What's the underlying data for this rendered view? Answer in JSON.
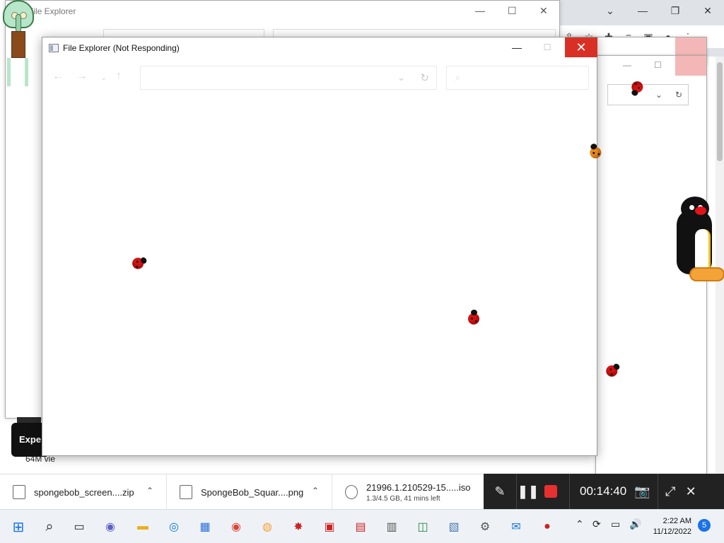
{
  "browser": {
    "controls": [
      "chevron-down",
      "minimize",
      "restore",
      "close"
    ]
  },
  "back_window": {
    "title": "File Explorer"
  },
  "main_window": {
    "title": "File Explorer (Not Responding)",
    "address_value": "",
    "search_placeholder": ""
  },
  "partial_content": {
    "video_label": "Exper",
    "views_text": "64M vie"
  },
  "downloads": [
    {
      "name": "spongebob_screen....zip",
      "icon": "zip-file-icon"
    },
    {
      "name": "SpongeBob_Squar....png",
      "icon": "png-file-icon"
    },
    {
      "name": "21996.1.210529-15.....iso",
      "sub": "1.3/4.5 GB, 41 mins left",
      "icon": "iso-file-icon"
    }
  ],
  "recorder": {
    "time": "00:14:40"
  },
  "taskbar": {
    "time": "2:22 AM",
    "date": "11/12/2022",
    "notification_count": "5"
  },
  "colors": {
    "close_red": "#d93025",
    "recorder_bg": "#222222",
    "taskbar_bg": "#eef2f6"
  }
}
